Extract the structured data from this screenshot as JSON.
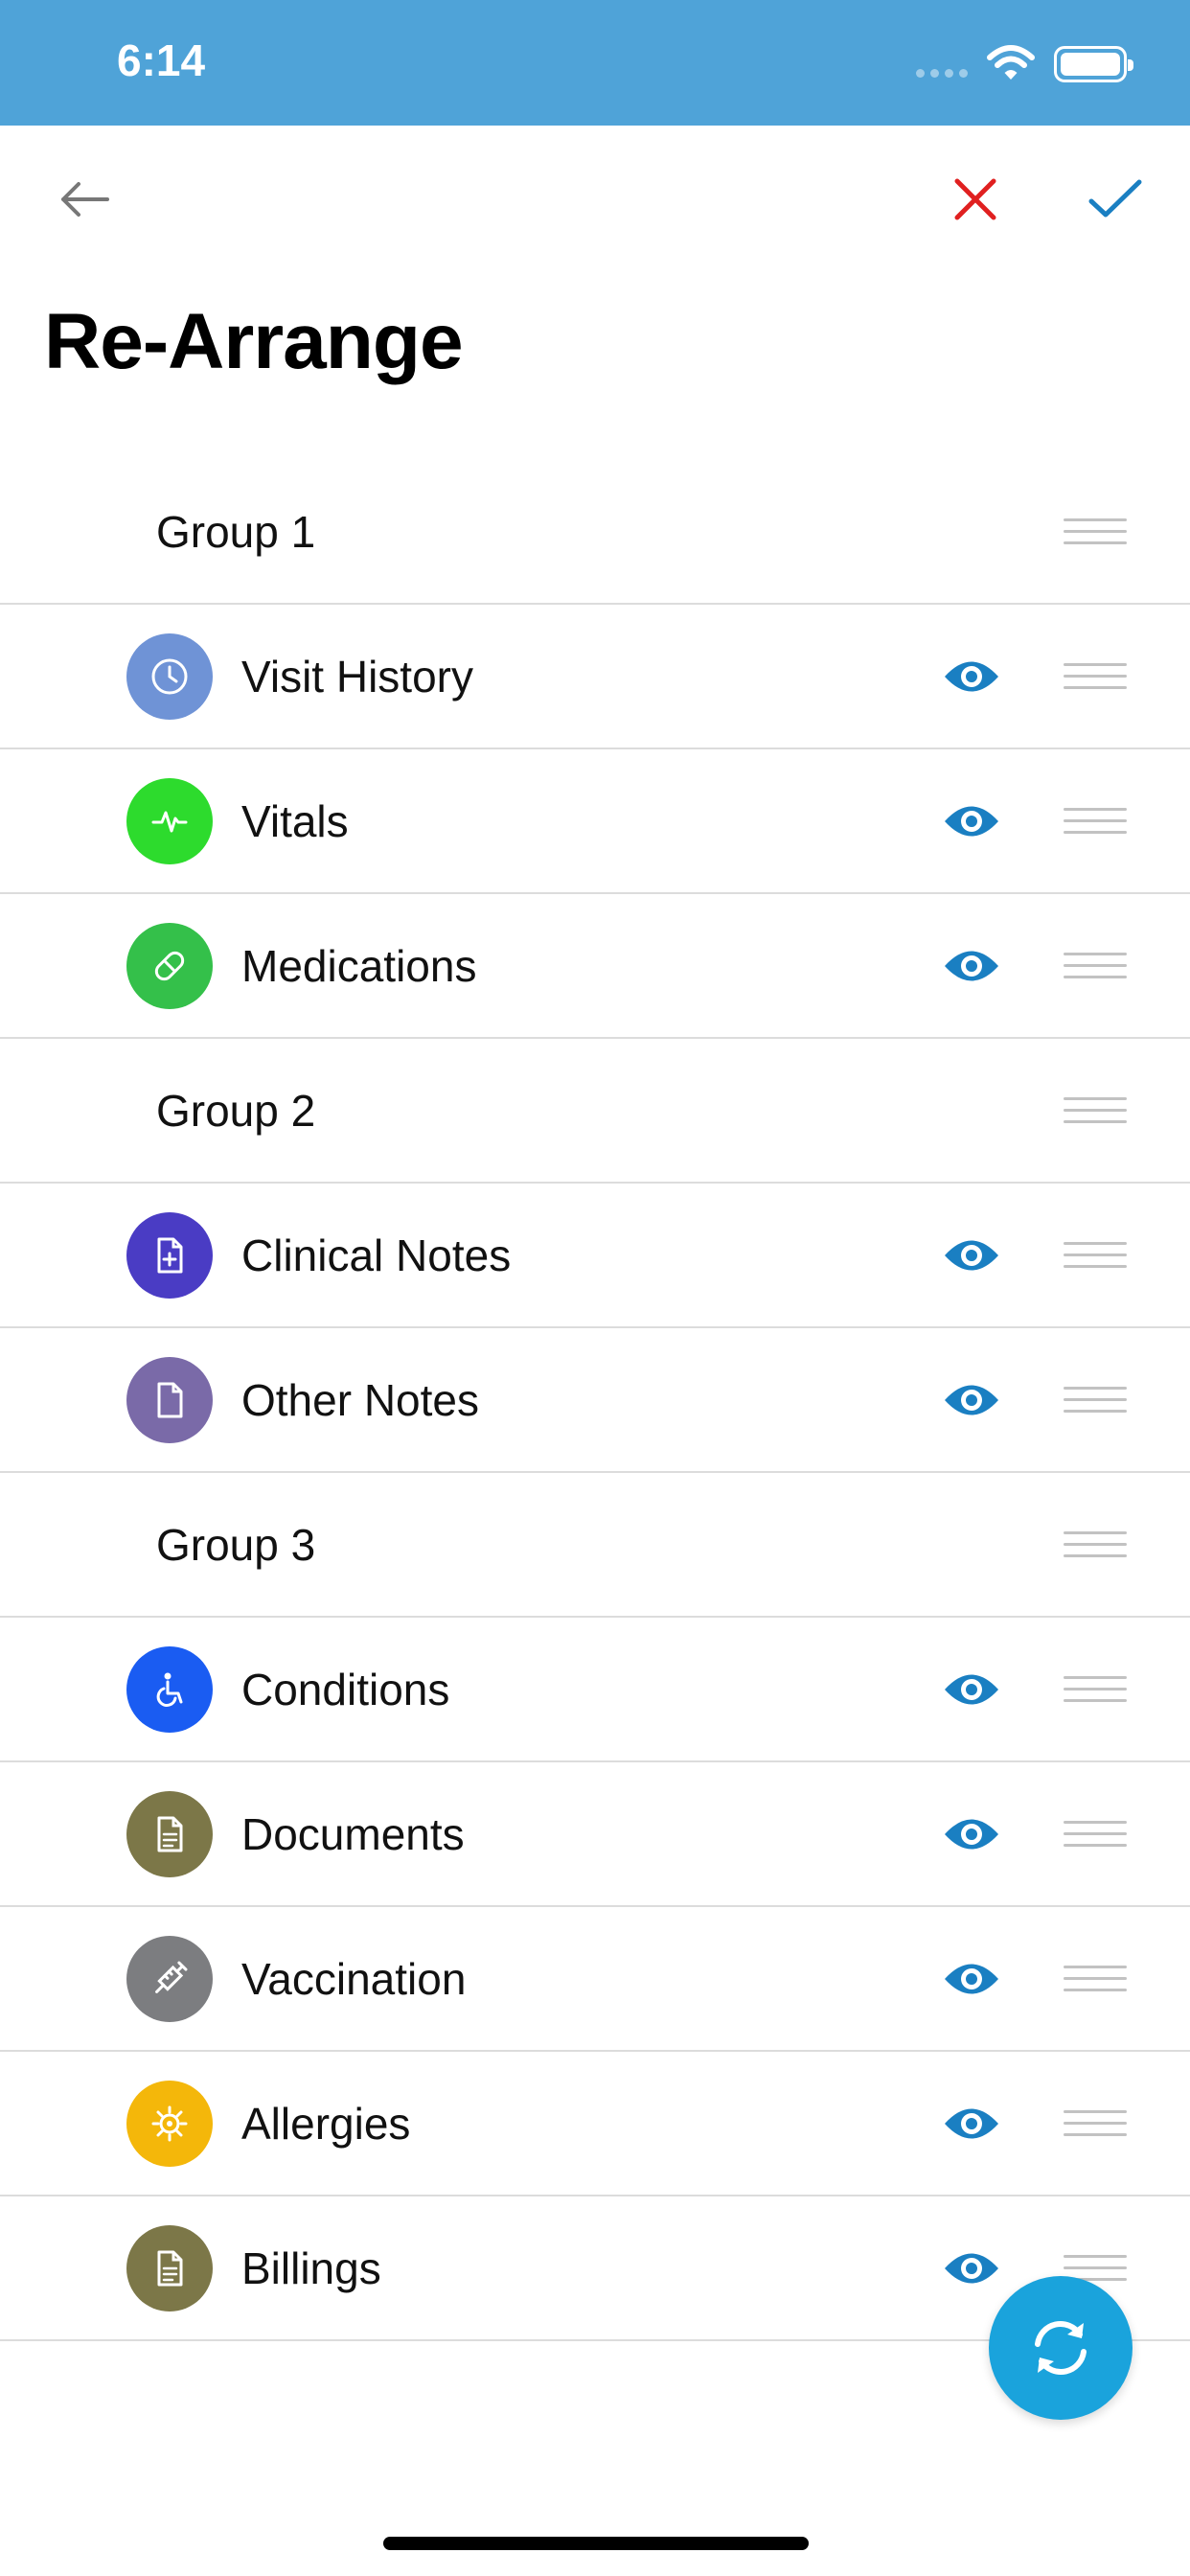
{
  "status_bar": {
    "time": "6:14"
  },
  "header": {
    "title": "Re-Arrange",
    "colors": {
      "cancel": "#e02020",
      "confirm": "#1a7fc2",
      "back": "#777777"
    }
  },
  "rows": [
    {
      "type": "group",
      "label": "Group 1"
    },
    {
      "type": "item",
      "label": "Visit History",
      "icon": "clock-icon",
      "color": "#6f93d6"
    },
    {
      "type": "item",
      "label": "Vitals",
      "icon": "heartbeat-icon",
      "color": "#2ddb2d"
    },
    {
      "type": "item",
      "label": "Medications",
      "icon": "pill-icon",
      "color": "#34c04a"
    },
    {
      "type": "group",
      "label": "Group 2"
    },
    {
      "type": "item",
      "label": "Clinical Notes",
      "icon": "medical-document-icon",
      "color": "#4a3cc4"
    },
    {
      "type": "item",
      "label": "Other Notes",
      "icon": "document-icon",
      "color": "#7a6aa8"
    },
    {
      "type": "group",
      "label": "Group 3"
    },
    {
      "type": "item",
      "label": "Conditions",
      "icon": "wheelchair-icon",
      "color": "#1a5cf2"
    },
    {
      "type": "item",
      "label": "Documents",
      "icon": "document-lines-icon",
      "color": "#7c7748"
    },
    {
      "type": "item",
      "label": "Vaccination",
      "icon": "syringe-icon",
      "color": "#7c7d80"
    },
    {
      "type": "item",
      "label": "Allergies",
      "icon": "allergen-icon",
      "color": "#f4b70a"
    },
    {
      "type": "item",
      "label": "Billings",
      "icon": "bill-document-icon",
      "color": "#7c7748"
    }
  ],
  "eye_color": "#1a7fc2",
  "fab": {
    "icon": "refresh-icon",
    "color": "#1aa3dc"
  }
}
